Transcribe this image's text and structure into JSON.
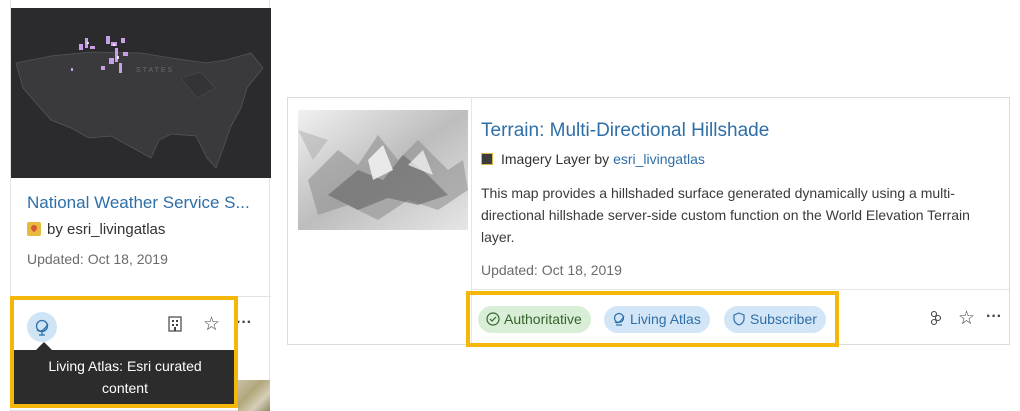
{
  "left_card": {
    "title": "National Weather Service S...",
    "owner_text": "by esri_livingatlas",
    "updated": "Updated: Oct 18, 2019",
    "tooltip_line1": "Living Atlas: Esri curated",
    "tooltip_line2": "content",
    "actions": {
      "building_icon": "🏢",
      "star_icon": "☆",
      "more_icon": "···"
    }
  },
  "right_card": {
    "title": "Terrain: Multi-Directional Hillshade",
    "type_label": "Imagery Layer by",
    "owner_link": "esri_livingatlas",
    "description": "This map provides a hillshaded surface generated dynamically using a multi-directional hillshade server-side custom function on the World Elevation Terrain layer.",
    "updated": "Updated: Oct 18, 2019",
    "badges": [
      {
        "label": "Authoritative",
        "icon": "check-circle-icon"
      },
      {
        "label": "Living Atlas",
        "icon": "globe-icon"
      },
      {
        "label": "Subscriber",
        "icon": "shield-icon"
      }
    ],
    "actions": {
      "share_icon": "♲",
      "star_icon": "☆",
      "more_icon": "···"
    }
  },
  "colors": {
    "link": "#2e6fa8",
    "highlight": "#f5b80a",
    "authoritative_bg": "#d9eed6",
    "atlas_bg": "#d3e6f7",
    "tooltip_bg": "#2c2c2c"
  }
}
